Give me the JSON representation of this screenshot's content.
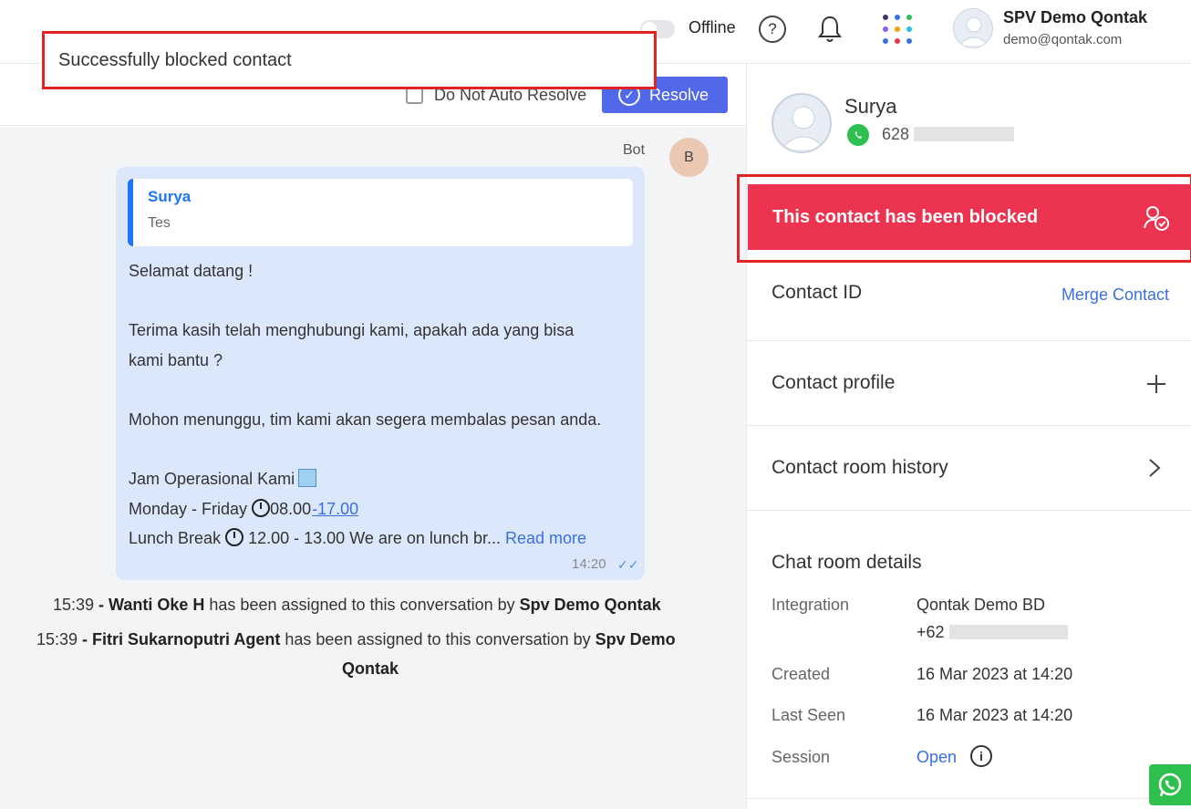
{
  "topbar": {
    "status": "Offline",
    "user_name": "SPV Demo Qontak",
    "user_email": "demo@qontak.com"
  },
  "toast": {
    "message": "Successfully blocked contact"
  },
  "chat_header": {
    "auto_resolve_label": "Do Not Auto Resolve",
    "resolve_label": "Resolve"
  },
  "chat": {
    "sender": "Bot",
    "sender_initial": "B",
    "reply": {
      "name": "Surya",
      "text": "Tes"
    },
    "lines": {
      "greeting": "Selamat datang !",
      "thanks_1": "Terima kasih telah menghubungi kami, apakah ada yang bisa",
      "thanks_2": "kami bantu ?",
      "wait": "Mohon menunggu, tim kami akan segera membalas pesan anda.",
      "hours_title": "Jam Operasional Kami",
      "weekday_prefix": "Monday - Friday",
      "weekday_start": "08.00",
      "weekday_end": "-17.00",
      "lunch_prefix": "Lunch Break",
      "lunch_text": "12.00 - 13.00 We are on lunch br...",
      "read_more": "Read more"
    },
    "time": "14:20",
    "system_messages": [
      {
        "time": "15:39",
        "sep": " - ",
        "agent": "Wanti Oke H",
        "text": " has been assigned to this conversation by ",
        "by": "Spv Demo Qontak"
      },
      {
        "time": "15:39",
        "sep": " - ",
        "agent": "Fitri Sukarnoputri Agent",
        "text": " has been assigned to this conversation by ",
        "by_1": "Spv Demo",
        "by_2": "Qontak"
      }
    ]
  },
  "contact": {
    "name": "Surya",
    "phone_prefix": "628",
    "blocked_message": "This contact has been blocked",
    "contact_id_label": "Contact ID",
    "merge_label": "Merge Contact",
    "profile_label": "Contact profile",
    "room_history_label": "Contact room history",
    "chat_room_details_label": "Chat room details",
    "details": {
      "integration_label": "Integration",
      "integration_value": "Qontak Demo BD",
      "integration_phone_prefix": "+62",
      "created_label": "Created",
      "created_value": "16 Mar 2023 at 14:20",
      "last_seen_label": "Last Seen",
      "last_seen_value": "16 Mar 2023 at 14:20",
      "session_label": "Session",
      "session_value": "Open"
    }
  },
  "colors": {
    "accent": "#5068e9",
    "blocked_banner": "#ec3350",
    "bubble": "#dbe8fb",
    "link": "#3b6fe0",
    "whatsapp": "#2fbf4f"
  }
}
